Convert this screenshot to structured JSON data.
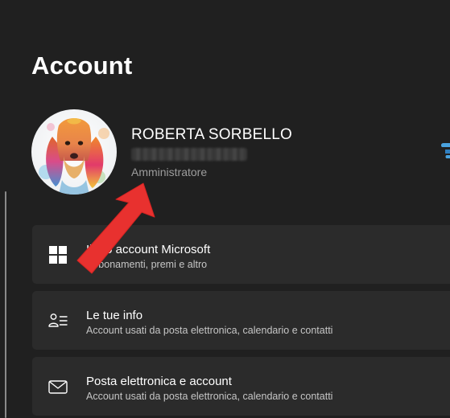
{
  "page": {
    "title": "Account"
  },
  "user": {
    "name": "ROBERTA SORBELLO",
    "role": "Amministratore"
  },
  "cards": [
    {
      "title": "Il tuo account Microsoft",
      "subtitle": "Abbonamenti, premi e altro",
      "icon": "windows-logo-icon"
    },
    {
      "title": "Le tue info",
      "subtitle": "Account usati da posta elettronica, calendario e contatti",
      "icon": "person-info-icon"
    },
    {
      "title": "Posta elettronica e account",
      "subtitle": "Account usati da posta elettronica, calendario e contatti",
      "icon": "mail-icon"
    }
  ],
  "colors": {
    "background": "#202020",
    "card": "#2b2b2b",
    "text_primary": "#ffffff",
    "text_secondary": "#c6c6c6",
    "role_text": "#9d9d9d",
    "annotation_arrow": "#e8312f",
    "accent_edge": "#4aa3df"
  }
}
